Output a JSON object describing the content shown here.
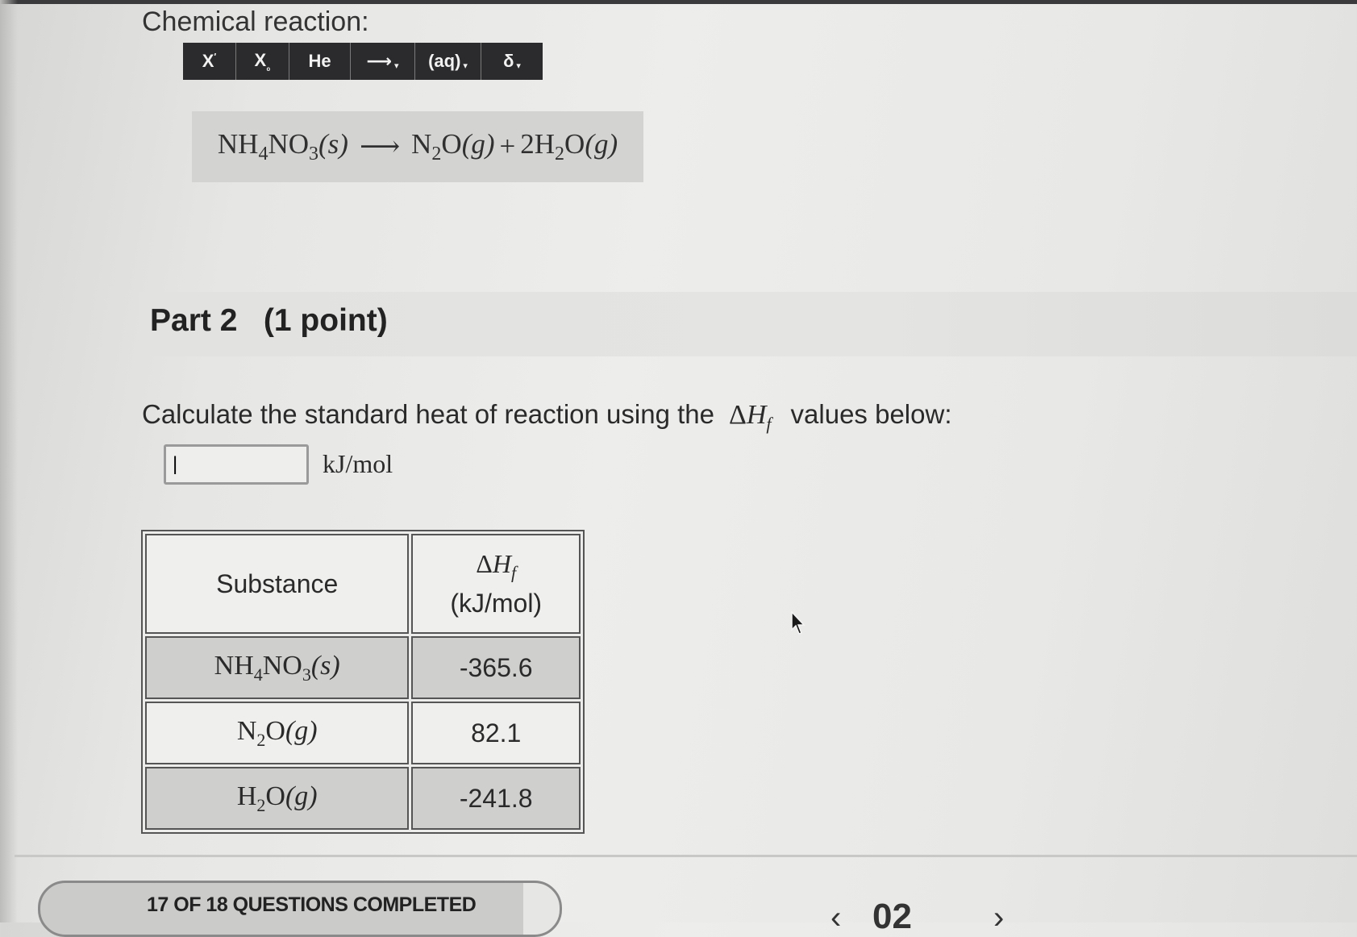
{
  "section": {
    "title": "Chemical reaction:"
  },
  "toolbar": {
    "buttons": [
      {
        "label": "X",
        "mark": "′",
        "icon": "superscript-icon"
      },
      {
        "label": "X",
        "mark": "₀",
        "icon": "subscript-icon"
      },
      {
        "label": "He",
        "icon": "element-icon"
      },
      {
        "label": "⟶",
        "icon": "reaction-arrow-icon"
      },
      {
        "label": "(aq)",
        "icon": "state-of-matter-icon"
      },
      {
        "label": "δ",
        "icon": "charge-delta-icon"
      }
    ]
  },
  "equation": {
    "reactant": {
      "a": "NH",
      "a_sub": "4",
      "b": "NO",
      "b_sub": "3",
      "state": "(s)"
    },
    "arrow": "⟶",
    "product1": {
      "a": "N",
      "a_sub": "2",
      "b": "O",
      "state": "(g)"
    },
    "plus": "+",
    "product2": {
      "coef": "2",
      "a": "H",
      "a_sub": "2",
      "b": "O",
      "state": "(g)"
    }
  },
  "part": {
    "title": "Part 2",
    "points": "(1 point)"
  },
  "question": {
    "text_before": "Calculate the standard heat of reaction using the",
    "symbol_delta": "Δ",
    "symbol_h": "H",
    "symbol_sub": "f",
    "text_after": "values below:"
  },
  "answer": {
    "value": "|",
    "unit": "kJ/mol"
  },
  "table": {
    "header_substance": "Substance",
    "header_dh_delta": "Δ",
    "header_dh_h": "H",
    "header_dh_sub": "f",
    "header_unit": "(kJ/mol)",
    "rows": [
      {
        "a": "NH",
        "a_sub": "4",
        "b": "NO",
        "b_sub": "3",
        "state": "(s)",
        "value": "-365.6"
      },
      {
        "a": "N",
        "a_sub": "2",
        "b": "O",
        "b_sub": "",
        "state": "(g)",
        "value": "82.1"
      },
      {
        "a": "H",
        "a_sub": "2",
        "b": "O",
        "b_sub": "",
        "state": "(g)",
        "value": "-241.8"
      }
    ]
  },
  "progress": {
    "text": "17 OF 18 QUESTIONS COMPLETED",
    "completed": 17,
    "total": 18
  },
  "navigation": {
    "prev": "‹",
    "page": "02",
    "next": "›"
  },
  "icons": {
    "cursor": "mouse-cursor-icon"
  }
}
